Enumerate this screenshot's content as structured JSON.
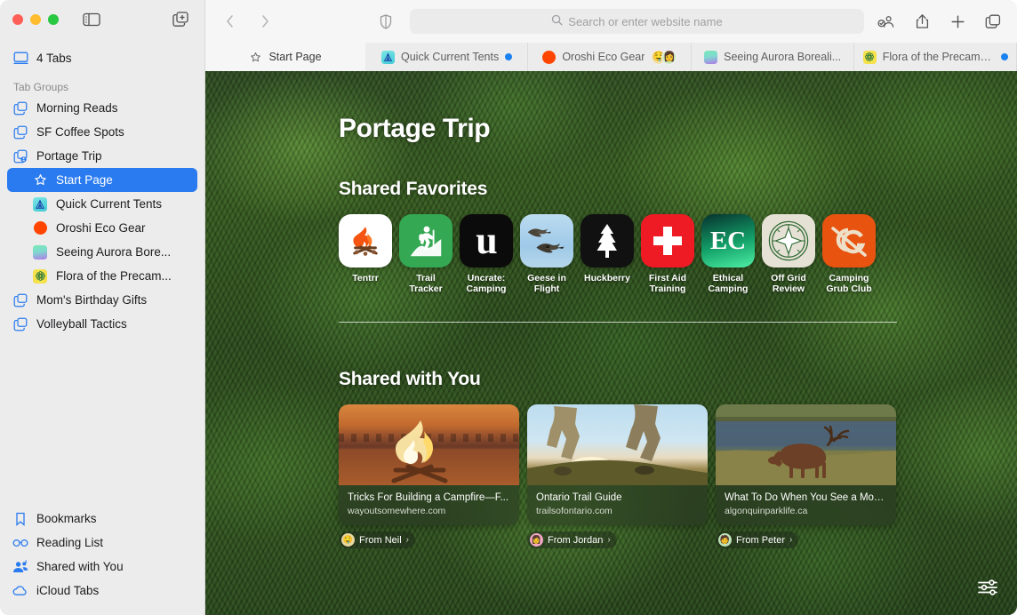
{
  "window": {
    "traffic_lights": [
      "close",
      "minimize",
      "zoom"
    ],
    "sidebar_toggle_icon": "sidebar-toggle-icon",
    "new_tab_group_icon": "new-tab-group-icon"
  },
  "sidebar": {
    "tabs_count_label": "4 Tabs",
    "tabs_icon": "display-icon",
    "section_header": "Tab Groups",
    "groups": [
      {
        "label": "Morning Reads",
        "icon": "tab-group-icon",
        "selected": false
      },
      {
        "label": "SF Coffee Spots",
        "icon": "tab-group-icon",
        "selected": false
      },
      {
        "label": "Portage Trip",
        "icon": "tab-group-shared-icon",
        "selected": false
      }
    ],
    "children": [
      {
        "label": "Start Page",
        "icon": "star-icon",
        "selected": true,
        "favicon_type": "star"
      },
      {
        "label": "Quick Current Tents",
        "icon": "favicon",
        "selected": false,
        "favicon_type": "tent",
        "color": "#4fd3d9"
      },
      {
        "label": "Oroshi Eco Gear",
        "icon": "favicon",
        "selected": false,
        "favicon_type": "circle",
        "color": "#ff4500"
      },
      {
        "label": "Seeing Aurora Bore...",
        "icon": "favicon",
        "selected": false,
        "favicon_type": "gradient",
        "color": "#6fe0b0"
      },
      {
        "label": "Flora of the Precam...",
        "icon": "favicon",
        "selected": false,
        "favicon_type": "flower",
        "color": "#f5e24a"
      }
    ],
    "groups_after": [
      {
        "label": "Mom's Birthday Gifts",
        "icon": "tab-group-icon",
        "selected": false
      },
      {
        "label": "Volleyball Tactics",
        "icon": "tab-group-icon",
        "selected": false
      }
    ],
    "bottom_items": [
      {
        "label": "Bookmarks",
        "icon": "bookmark-icon"
      },
      {
        "label": "Reading List",
        "icon": "glasses-icon"
      },
      {
        "label": "Shared with You",
        "icon": "shared-with-you-icon"
      },
      {
        "label": "iCloud Tabs",
        "icon": "cloud-icon"
      }
    ]
  },
  "toolbar": {
    "back_icon": "chevron-left-icon",
    "forward_icon": "chevron-right-icon",
    "shield_icon": "privacy-shield-icon",
    "search_placeholder": "Search or enter website name",
    "search_value": "",
    "search_icon": "search-icon",
    "right_icons": [
      {
        "name": "share-group-icon"
      },
      {
        "name": "share-icon"
      },
      {
        "name": "new-tab-plus-icon"
      },
      {
        "name": "tab-overview-icon"
      }
    ]
  },
  "tabbar": {
    "tabs": [
      {
        "label": "Start Page",
        "icon": "star-icon",
        "active": true,
        "favicon_type": "star",
        "badge": "none"
      },
      {
        "label": "Quick Current Tents",
        "icon": "favicon",
        "active": false,
        "favicon_type": "tent",
        "color": "#4fd3d9",
        "badge": "blue-dot"
      },
      {
        "label": "Oroshi Eco Gear",
        "icon": "favicon",
        "active": false,
        "favicon_type": "circle",
        "color": "#ff4500",
        "badge": "avatars",
        "avatars": [
          "🧔",
          "👩🏿"
        ]
      },
      {
        "label": "Seeing Aurora Boreali...",
        "icon": "favicon",
        "active": false,
        "favicon_type": "gradient",
        "color": "#6fe0b0",
        "badge": "none"
      },
      {
        "label": "Flora of the Precambi...",
        "icon": "favicon",
        "active": false,
        "favicon_type": "flower",
        "color": "#f5e24a",
        "badge": "blue-dot"
      }
    ]
  },
  "start_page": {
    "title": "Portage Trip",
    "favorites_heading": "Shared Favorites",
    "favorites": [
      {
        "name": "Tentrr",
        "icon": "campfire-icon",
        "bg": "#ffffff"
      },
      {
        "name": "Trail Tracker",
        "icon": "hiker-icon",
        "bg": "#34a853"
      },
      {
        "name": "Uncrate: Camping",
        "icon": "letter-u-icon",
        "bg": "#0b0b0b"
      },
      {
        "name": "Geese in Flight",
        "icon": "geese-icon",
        "bg": "#a8cde8"
      },
      {
        "name": "Huckberry",
        "icon": "pine-tree-icon",
        "bg": "#111111"
      },
      {
        "name": "First Aid Training",
        "icon": "first-aid-cross-icon",
        "bg": "#ef1b24"
      },
      {
        "name": "Ethical Camping",
        "icon": "ec-monogram-icon",
        "bg": "#1fc47e"
      },
      {
        "name": "Off Grid Review",
        "icon": "compass-icon",
        "bg": "#e6e1d5"
      },
      {
        "name": "Camping Grub Club",
        "icon": "cg-monogram-icon",
        "bg": "#e8530f"
      }
    ],
    "shared_heading": "Shared with You",
    "shared_cards": [
      {
        "title": "Tricks For Building a Campfire—F...",
        "url": "wayoutsomewhere.com",
        "from": "From Neil",
        "avatar": "🧔",
        "avatar_bg": "#e8d9a0",
        "image": "campfire-photo"
      },
      {
        "title": "Ontario Trail Guide",
        "url": "trailsofontario.com",
        "from": "From Jordan",
        "avatar": "👩",
        "avatar_bg": "#f3a8c6",
        "image": "hikers-sunset-photo"
      },
      {
        "title": "What To Do When You See a Moo...",
        "url": "algonquinparklife.ca",
        "from": "From Peter",
        "avatar": "🧑",
        "avatar_bg": "#bfe3b8",
        "image": "moose-lake-photo"
      }
    ],
    "settings_icon": "start-page-settings-icon"
  },
  "colors": {
    "accent": "#2a7bf0",
    "sidebar_bg": "#ececec",
    "toolbar_bg": "#f6f6f6",
    "blue_dot": "#1a82f0"
  }
}
